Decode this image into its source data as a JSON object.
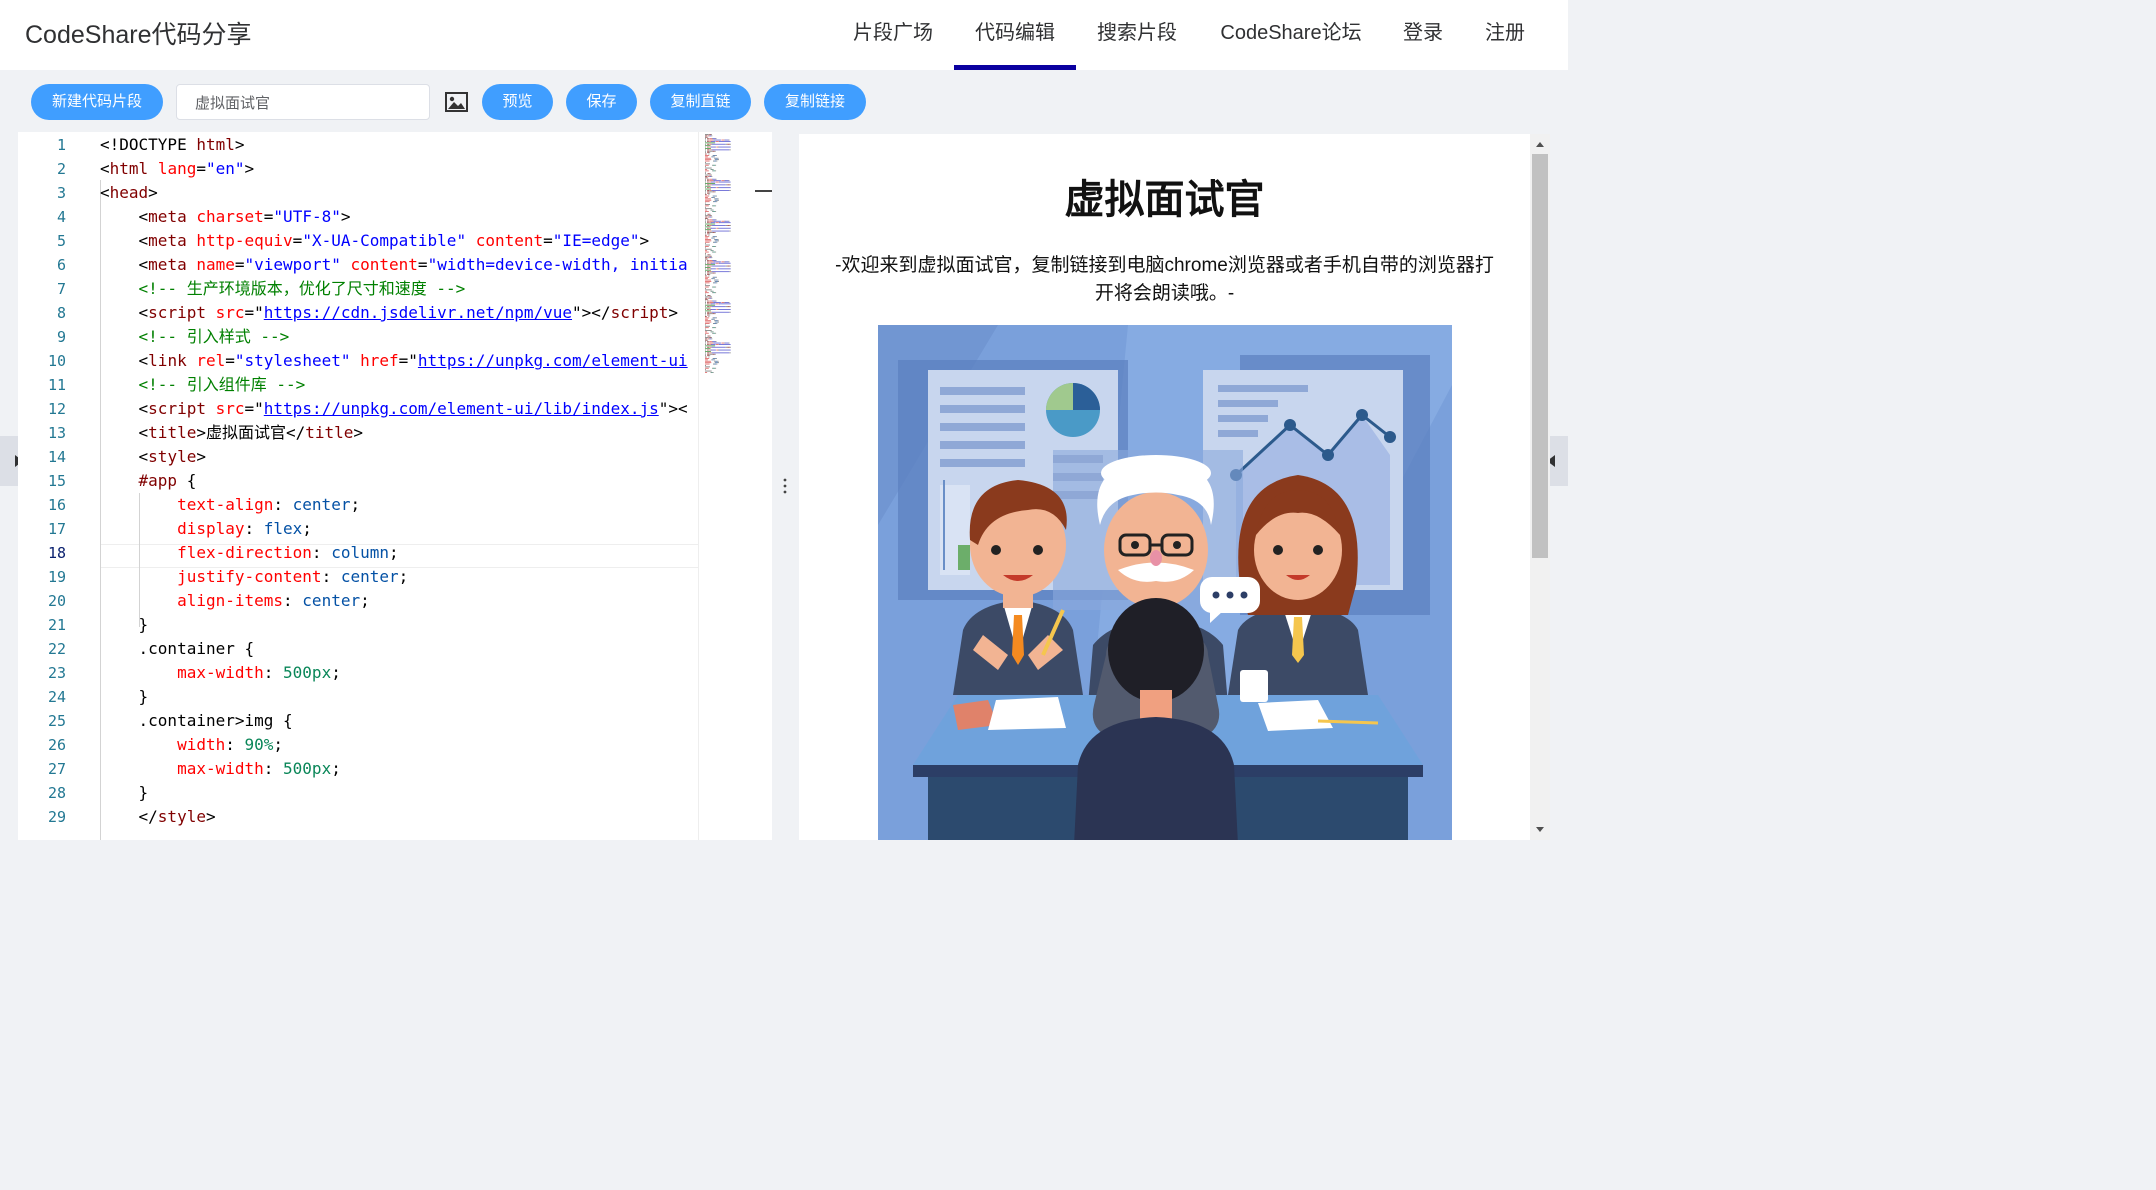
{
  "header": {
    "brand": "CodeShare代码分享",
    "nav": [
      {
        "label": "片段广场",
        "active": false
      },
      {
        "label": "代码编辑",
        "active": true
      },
      {
        "label": "搜索片段",
        "active": false
      },
      {
        "label": "CodeShare论坛",
        "active": false
      },
      {
        "label": "登录",
        "active": false
      },
      {
        "label": "注册",
        "active": false
      }
    ]
  },
  "toolbar": {
    "new_label": "新建代码片段",
    "title_value": "虚拟面试官",
    "preview_label": "预览",
    "save_label": "保存",
    "copy_direct_label": "复制直链",
    "copy_link_label": "复制链接",
    "image_icon": "image-icon"
  },
  "editor": {
    "current_line": 18,
    "lines": [
      [
        [
          "t-txt",
          "<!DOCTYPE "
        ],
        [
          "t-tag",
          "html"
        ],
        [
          "t-txt",
          ">"
        ]
      ],
      [
        [
          "t-txt",
          "<"
        ],
        [
          "t-tag",
          "html"
        ],
        [
          "t-txt",
          " "
        ],
        [
          "t-attr",
          "lang"
        ],
        [
          "t-txt",
          "="
        ],
        [
          "t-str",
          "\"en\""
        ],
        [
          "t-txt",
          ">"
        ]
      ],
      [
        [
          "t-txt",
          "<"
        ],
        [
          "t-tag",
          "head"
        ],
        [
          "t-txt",
          ">"
        ]
      ],
      [
        [
          "t-txt",
          "    <"
        ],
        [
          "t-tag",
          "meta"
        ],
        [
          "t-txt",
          " "
        ],
        [
          "t-attr",
          "charset"
        ],
        [
          "t-txt",
          "="
        ],
        [
          "t-str",
          "\"UTF-8\""
        ],
        [
          "t-txt",
          ">"
        ]
      ],
      [
        [
          "t-txt",
          "    <"
        ],
        [
          "t-tag",
          "meta"
        ],
        [
          "t-txt",
          " "
        ],
        [
          "t-attr",
          "http-equiv"
        ],
        [
          "t-txt",
          "="
        ],
        [
          "t-str",
          "\"X-UA-Compatible\""
        ],
        [
          "t-txt",
          " "
        ],
        [
          "t-attr",
          "content"
        ],
        [
          "t-txt",
          "="
        ],
        [
          "t-str",
          "\"IE=edge\""
        ],
        [
          "t-txt",
          ">"
        ]
      ],
      [
        [
          "t-txt",
          "    <"
        ],
        [
          "t-tag",
          "meta"
        ],
        [
          "t-txt",
          " "
        ],
        [
          "t-attr",
          "name"
        ],
        [
          "t-txt",
          "="
        ],
        [
          "t-str",
          "\"viewport\""
        ],
        [
          "t-txt",
          " "
        ],
        [
          "t-attr",
          "content"
        ],
        [
          "t-txt",
          "="
        ],
        [
          "t-str",
          "\"width=device-width, initia"
        ]
      ],
      [
        [
          "t-com",
          "    <!-- 生产环境版本，优化了尺寸和速度 -->"
        ]
      ],
      [
        [
          "t-txt",
          "    <"
        ],
        [
          "t-tag",
          "script"
        ],
        [
          "t-txt",
          " "
        ],
        [
          "t-attr",
          "src"
        ],
        [
          "t-txt",
          "=\""
        ],
        [
          "t-link",
          "https://cdn.jsdelivr.net/npm/vue"
        ],
        [
          "t-txt",
          "\"></"
        ],
        [
          "t-tag",
          "script"
        ],
        [
          "t-txt",
          ">"
        ]
      ],
      [
        [
          "t-com",
          "    <!-- 引入样式 -->"
        ]
      ],
      [
        [
          "t-txt",
          "    <"
        ],
        [
          "t-tag",
          "link"
        ],
        [
          "t-txt",
          " "
        ],
        [
          "t-attr",
          "rel"
        ],
        [
          "t-txt",
          "="
        ],
        [
          "t-str",
          "\"stylesheet\""
        ],
        [
          "t-txt",
          " "
        ],
        [
          "t-attr",
          "href"
        ],
        [
          "t-txt",
          "=\""
        ],
        [
          "t-link",
          "https://unpkg.com/element-ui"
        ]
      ],
      [
        [
          "t-com",
          "    <!-- 引入组件库 -->"
        ]
      ],
      [
        [
          "t-txt",
          "    <"
        ],
        [
          "t-tag",
          "script"
        ],
        [
          "t-txt",
          " "
        ],
        [
          "t-attr",
          "src"
        ],
        [
          "t-txt",
          "=\""
        ],
        [
          "t-link",
          "https://unpkg.com/element-ui/lib/index.js"
        ],
        [
          "t-txt",
          "\"><"
        ]
      ],
      [
        [
          "t-txt",
          "    <"
        ],
        [
          "t-tag",
          "title"
        ],
        [
          "t-txt",
          ">虚拟面试官</"
        ],
        [
          "t-tag",
          "title"
        ],
        [
          "t-txt",
          ">"
        ]
      ],
      [
        [
          "t-txt",
          "    <"
        ],
        [
          "t-tag",
          "style"
        ],
        [
          "t-txt",
          ">"
        ]
      ],
      [
        [
          "t-sel",
          "    #app"
        ],
        [
          "t-txt",
          " {"
        ]
      ],
      [
        [
          "t-prop",
          "        text-align"
        ],
        [
          "t-txt",
          ": "
        ],
        [
          "t-val",
          "center"
        ],
        [
          "t-txt",
          ";"
        ]
      ],
      [
        [
          "t-prop",
          "        display"
        ],
        [
          "t-txt",
          ": "
        ],
        [
          "t-val",
          "flex"
        ],
        [
          "t-txt",
          ";"
        ]
      ],
      [
        [
          "t-prop",
          "        flex-direction"
        ],
        [
          "t-txt",
          ": "
        ],
        [
          "t-val",
          "column"
        ],
        [
          "t-txt",
          ";"
        ]
      ],
      [
        [
          "t-prop",
          "        justify-content"
        ],
        [
          "t-txt",
          ": "
        ],
        [
          "t-val",
          "center"
        ],
        [
          "t-txt",
          ";"
        ]
      ],
      [
        [
          "t-prop",
          "        align-items"
        ],
        [
          "t-txt",
          ": "
        ],
        [
          "t-val",
          "center"
        ],
        [
          "t-txt",
          ";"
        ]
      ],
      [
        [
          "t-txt",
          "    }"
        ]
      ],
      [
        [
          "t-txt",
          "    .container {"
        ]
      ],
      [
        [
          "t-prop",
          "        max-width"
        ],
        [
          "t-txt",
          ": "
        ],
        [
          "t-num",
          "500px"
        ],
        [
          "t-txt",
          ";"
        ]
      ],
      [
        [
          "t-txt",
          "    }"
        ]
      ],
      [
        [
          "t-txt",
          "    .container>img {"
        ]
      ],
      [
        [
          "t-prop",
          "        width"
        ],
        [
          "t-txt",
          ": "
        ],
        [
          "t-num",
          "90%"
        ],
        [
          "t-txt",
          ";"
        ]
      ],
      [
        [
          "t-prop",
          "        max-width"
        ],
        [
          "t-txt",
          ": "
        ],
        [
          "t-num",
          "500px"
        ],
        [
          "t-txt",
          ";"
        ]
      ],
      [
        [
          "t-txt",
          "    }"
        ]
      ],
      [
        [
          "t-txt",
          "    </"
        ],
        [
          "t-tag",
          "style"
        ],
        [
          "t-txt",
          ">"
        ]
      ]
    ]
  },
  "preview": {
    "title": "虚拟面试官",
    "description": "-欢迎来到虚拟面试官，复制链接到电脑chrome浏览器或者手机自带的浏览器打开将会朗读哦。-",
    "illustration_icon": "interview-illustration"
  },
  "colors": {
    "accent": "#409eff",
    "nav_active": "#0a00a0",
    "page_bg": "#f0f2f5"
  }
}
